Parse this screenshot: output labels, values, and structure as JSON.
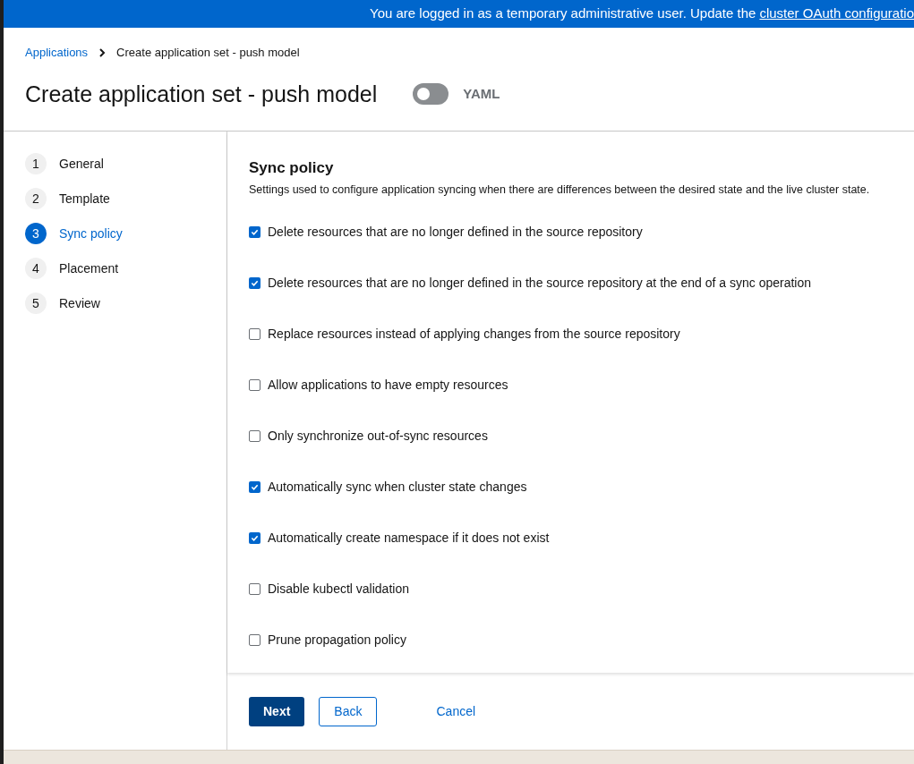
{
  "banner": {
    "text": "You are logged in as a temporary administrative user. Update the",
    "link": "cluster OAuth configuratio"
  },
  "breadcrumb": [
    {
      "label": "Applications",
      "kind": "link"
    },
    {
      "label": "Create application set - push model",
      "kind": "current"
    }
  ],
  "title": "Create application set - push model",
  "yaml_toggle": {
    "label": "YAML",
    "on": false
  },
  "steps": [
    {
      "number": "1",
      "label": "General",
      "selected": false
    },
    {
      "number": "2",
      "label": "Template",
      "selected": false
    },
    {
      "number": "3",
      "label": "Sync policy",
      "selected": true
    },
    {
      "number": "4",
      "label": "Placement",
      "selected": false
    },
    {
      "number": "5",
      "label": "Review",
      "selected": false
    }
  ],
  "section": {
    "title": "Sync policy",
    "description": "Settings used to configure application syncing when there are differences between the desired state and the live cluster state."
  },
  "options": [
    {
      "label": "Delete resources that are no longer defined in the source repository",
      "checked": true
    },
    {
      "label": "Delete resources that are no longer defined in the source repository at the end of a sync operation",
      "checked": true
    },
    {
      "label": "Replace resources instead of applying changes from the source repository",
      "checked": false
    },
    {
      "label": "Allow applications to have empty resources",
      "checked": false
    },
    {
      "label": "Only synchronize out-of-sync resources",
      "checked": false
    },
    {
      "label": "Automatically sync when cluster state changes",
      "checked": true
    },
    {
      "label": "Automatically create namespace if it does not exist",
      "checked": true
    },
    {
      "label": "Disable kubectl validation",
      "checked": false
    },
    {
      "label": "Prune propagation policy",
      "checked": false
    }
  ],
  "buttons": [
    {
      "label": "Next",
      "kind": "primary"
    },
    {
      "label": "Back",
      "kind": "secondary"
    },
    {
      "label": "Cancel",
      "kind": "link"
    }
  ]
}
